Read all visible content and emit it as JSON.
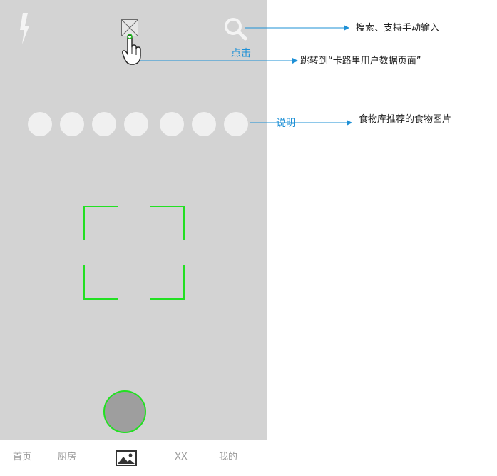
{
  "screen": {
    "click_label": "点击",
    "background_color": "#d3d3d3",
    "accent_color": "#22e022",
    "dot_count": 7
  },
  "icons": {
    "flash": "flash-icon",
    "image_placeholder": "image-placeholder-icon",
    "hand": "hand-pointer-icon",
    "search": "search-icon",
    "tab_image": "image-icon"
  },
  "tabbar": {
    "home": "首页",
    "kitchen": "厨房",
    "xx": "XX",
    "mine": "我的"
  },
  "annotations": {
    "search_note": "搜索、支持手动输入",
    "jump_note": "跳转到“卡路里用户数据页面”",
    "explain_label": "说明",
    "recommend_note": "食物库推荐的食物图片",
    "line_color": "#1e90d6"
  }
}
